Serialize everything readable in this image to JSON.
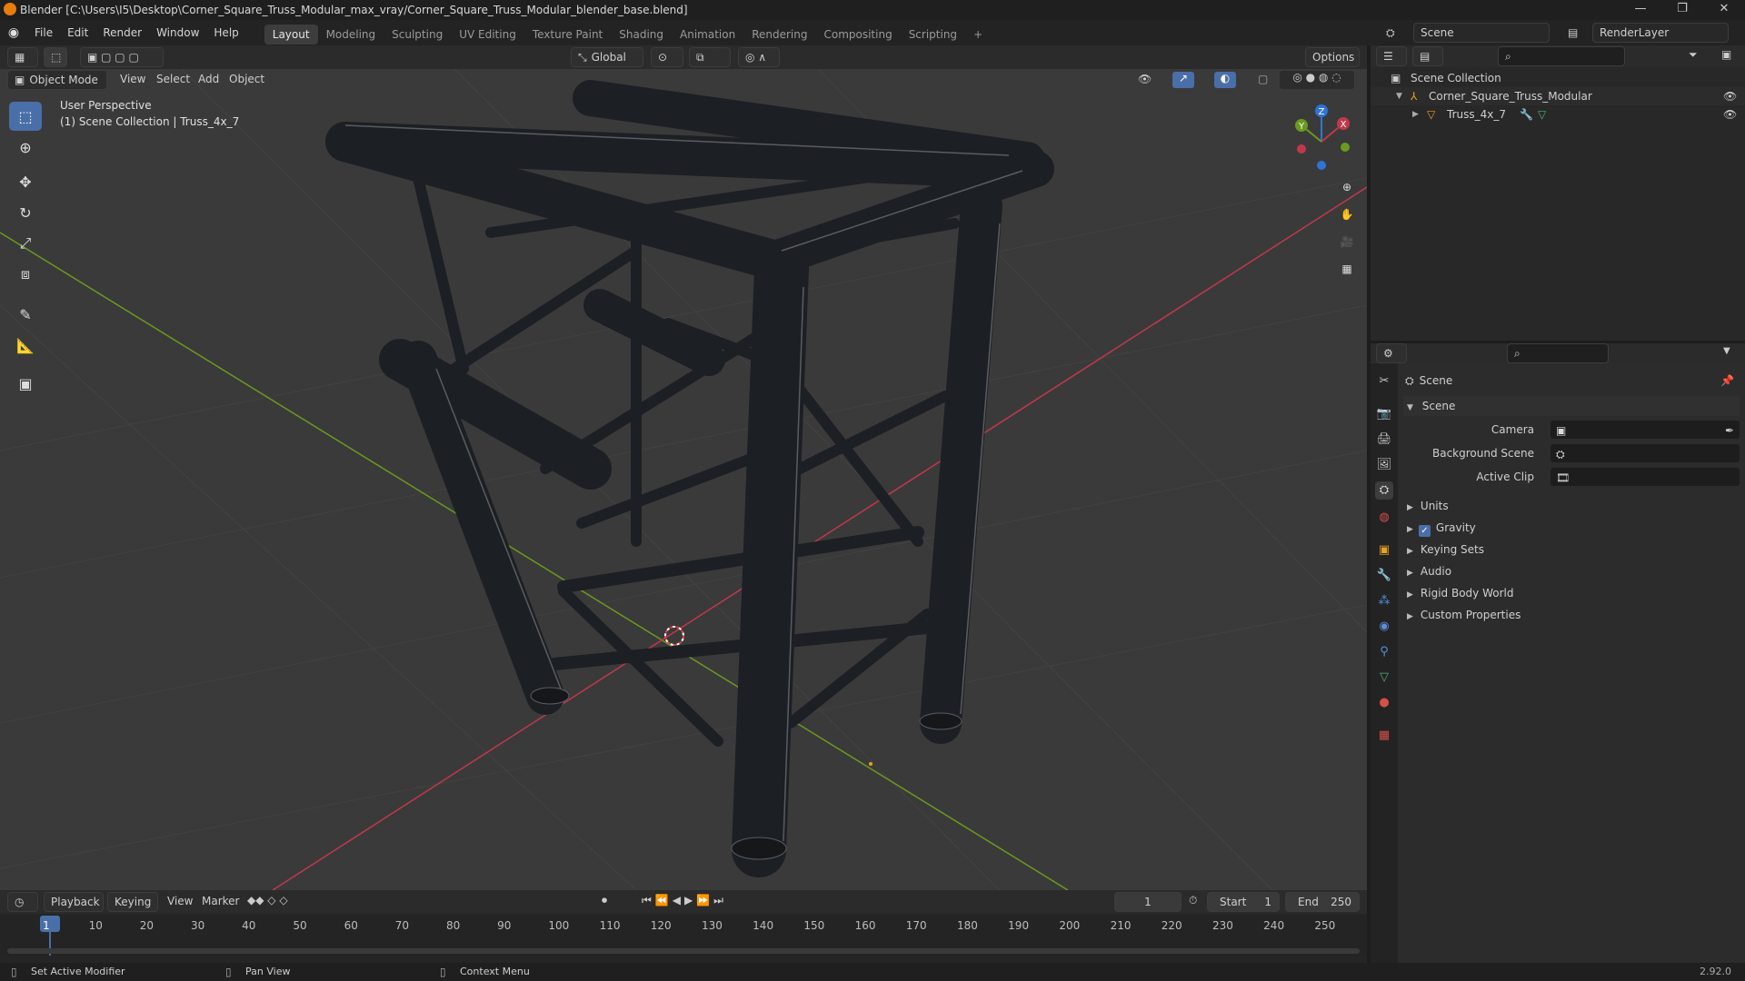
{
  "window": {
    "title": "Blender [C:\\Users\\I5\\Desktop\\Corner_Square_Truss_Modular_max_vray/Corner_Square_Truss_Modular_blender_base.blend]",
    "min": "—",
    "max": "❐",
    "close": "✕"
  },
  "menus": [
    "File",
    "Edit",
    "Render",
    "Window",
    "Help"
  ],
  "workspaces": [
    "Layout",
    "Modeling",
    "Sculpting",
    "UV Editing",
    "Texture Paint",
    "Shading",
    "Animation",
    "Rendering",
    "Compositing",
    "Scripting"
  ],
  "workspace_add": "+",
  "scene_selector": {
    "value": "Scene"
  },
  "renderlayer_selector": {
    "value": "RenderLayer"
  },
  "toolbar": {
    "transform_orientation": "Global",
    "options": "Options"
  },
  "viewport_header": {
    "mode": "Object Mode",
    "menus": [
      "View",
      "Select",
      "Add",
      "Object"
    ]
  },
  "viewport": {
    "overlay_line1": "User Perspective",
    "overlay_line2": "(1) Scene Collection | Truss_4x_7",
    "gizmo": {
      "x": "X",
      "y": "Y",
      "z": "Z"
    }
  },
  "outliner": {
    "root": "Scene Collection",
    "collection": "Corner_Square_Truss_Modular",
    "object": "Truss_4x_7"
  },
  "properties": {
    "context": "Scene",
    "panel": "Scene",
    "camera_label": "Camera",
    "background_label": "Background Scene",
    "clip_label": "Active Clip",
    "sections": [
      "Units",
      "Gravity",
      "Keying Sets",
      "Audio",
      "Rigid Body World",
      "Custom Properties"
    ],
    "gravity_checked": true
  },
  "timeline": {
    "menus": [
      "Playback",
      "Keying",
      "View",
      "Marker"
    ],
    "current_frame": "1",
    "start_label": "Start",
    "start": "1",
    "end_label": "End",
    "end": "250",
    "ticks": [
      "1",
      "10",
      "20",
      "30",
      "40",
      "50",
      "60",
      "70",
      "80",
      "90",
      "100",
      "110",
      "120",
      "130",
      "140",
      "150",
      "160",
      "170",
      "180",
      "190",
      "200",
      "210",
      "220",
      "230",
      "240",
      "250"
    ]
  },
  "status": {
    "left": "Set Active Modifier",
    "middle": "Pan View",
    "right": "Context Menu",
    "version": "2.92.0"
  },
  "colors": {
    "accent": "#4a6fa8",
    "x_axis": "#c0394b",
    "y_axis": "#6a9a1e",
    "z_axis": "#2f73d6",
    "viewport_bg": "#3a3a3a"
  }
}
